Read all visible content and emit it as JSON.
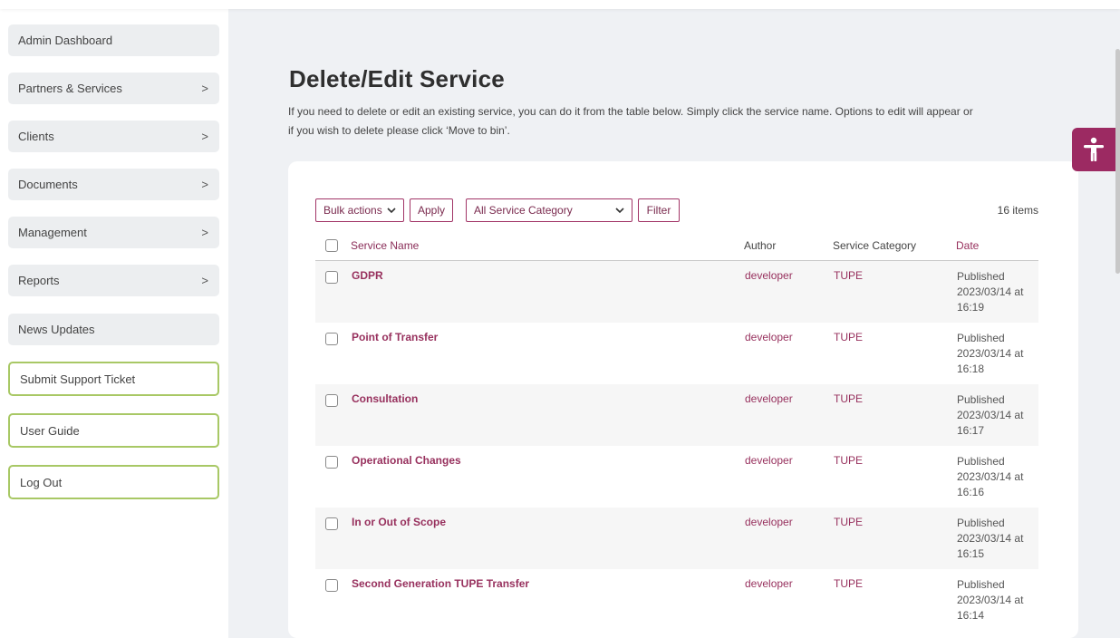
{
  "sidebar": {
    "items": [
      {
        "label": "Admin Dashboard",
        "chevron": ""
      },
      {
        "label": "Partners & Services",
        "chevron": ">"
      },
      {
        "label": "Clients",
        "chevron": ">"
      },
      {
        "label": "Documents",
        "chevron": ">"
      },
      {
        "label": "Management",
        "chevron": ">"
      },
      {
        "label": "Reports",
        "chevron": ">"
      },
      {
        "label": "News Updates",
        "chevron": ""
      },
      {
        "label": "Submit Support Ticket",
        "chevron": ""
      },
      {
        "label": "User Guide",
        "chevron": ""
      },
      {
        "label": "Log Out",
        "chevron": ""
      }
    ]
  },
  "page": {
    "title": "Delete/Edit Service",
    "intro_line1": "If you need to delete or edit an existing service, you can do it from the table below. Simply click the service name. Options to edit will appear or",
    "intro_line2": "if you wish to delete please click ‘Move to bin’."
  },
  "toolbar": {
    "bulk_actions": "Bulk actions",
    "apply": "Apply",
    "category_select": "All Service Category",
    "filter": "Filter",
    "items_count": "16 items"
  },
  "table": {
    "headers": {
      "name": "Service Name",
      "author": "Author",
      "category": "Service Category",
      "date": "Date"
    },
    "rows": [
      {
        "name": "GDPR",
        "author": "developer",
        "category": "TUPE",
        "status": "Published",
        "date": "2023/03/14 at",
        "time": "16:19"
      },
      {
        "name": "Point of Transfer",
        "author": "developer",
        "category": "TUPE",
        "status": "Published",
        "date": "2023/03/14 at",
        "time": "16:18"
      },
      {
        "name": "Consultation",
        "author": "developer",
        "category": "TUPE",
        "status": "Published",
        "date": "2023/03/14 at",
        "time": "16:17"
      },
      {
        "name": "Operational Changes",
        "author": "developer",
        "category": "TUPE",
        "status": "Published",
        "date": "2023/03/14 at",
        "time": "16:16"
      },
      {
        "name": "In or Out of Scope",
        "author": "developer",
        "category": "TUPE",
        "status": "Published",
        "date": "2023/03/14 at",
        "time": "16:15"
      },
      {
        "name": "Second Generation TUPE Transfer",
        "author": "developer",
        "category": "TUPE",
        "status": "Published",
        "date": "2023/03/14 at",
        "time": "16:14"
      }
    ]
  },
  "accessibility": {
    "icon": "accessibility-icon",
    "color": "#9c2a62"
  },
  "colors": {
    "accent": "#97305d",
    "outline_green": "#a8c865"
  }
}
